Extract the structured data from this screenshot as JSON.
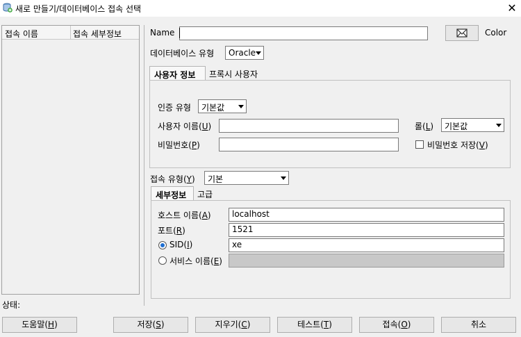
{
  "window": {
    "title": "새로 만들기/데이터베이스 접속 선택",
    "close_glyph": "✕"
  },
  "left_panel": {
    "columns": [
      "접속 이름",
      "접속 세부정보"
    ]
  },
  "name_field": {
    "label": "Name",
    "value": ""
  },
  "color_button": {
    "label": "Color",
    "icon": "envelope-icon"
  },
  "db_type": {
    "label": "데이터베이스 유형",
    "selected": "Oracle"
  },
  "top_tabs": [
    "사용자 정보",
    "프록시 사용자"
  ],
  "auth": {
    "type_label": "인증 유형",
    "type_value": "기본값",
    "user_label": "사용자 이름(",
    "user_mnemonic": "U",
    "user_value": "",
    "role_label": "롤(",
    "role_mnemonic": "L",
    "role_value": "기본값",
    "password_label": "비밀번호(",
    "password_mnemonic": "P",
    "password_value": "",
    "save_password_label": "비밀번호 저장(",
    "save_password_mnemonic": "V",
    "save_password_checked": false
  },
  "connection_type": {
    "label": "접속 유형(",
    "mnemonic": "Y",
    "value": "기본"
  },
  "detail_tabs": [
    "세부정보",
    "고급"
  ],
  "details": {
    "host_label": "호스트 이름(",
    "host_mnemonic": "A",
    "host_value": "localhost",
    "port_label": "포트(",
    "port_mnemonic": "R",
    "port_value": "1521",
    "sid_label": "SID(",
    "sid_mnemonic": "I",
    "sid_value": "xe",
    "sid_selected": true,
    "service_label": "서비스 이름(",
    "service_mnemonic": "E",
    "service_value": ""
  },
  "status": {
    "label": "상태:"
  },
  "buttons": {
    "help": {
      "label": "도움말(",
      "mnemonic": "H"
    },
    "save": {
      "label": "저장(",
      "mnemonic": "S"
    },
    "clear": {
      "label": "지우기(",
      "mnemonic": "C"
    },
    "test": {
      "label": "테스트(",
      "mnemonic": "T"
    },
    "connect": {
      "label": "접속(",
      "mnemonic": "O"
    },
    "cancel": {
      "label": "취소"
    }
  },
  "colors": {
    "accent": "#1f6fd1",
    "icon_green": "#3aa63a",
    "close": "#000000"
  }
}
